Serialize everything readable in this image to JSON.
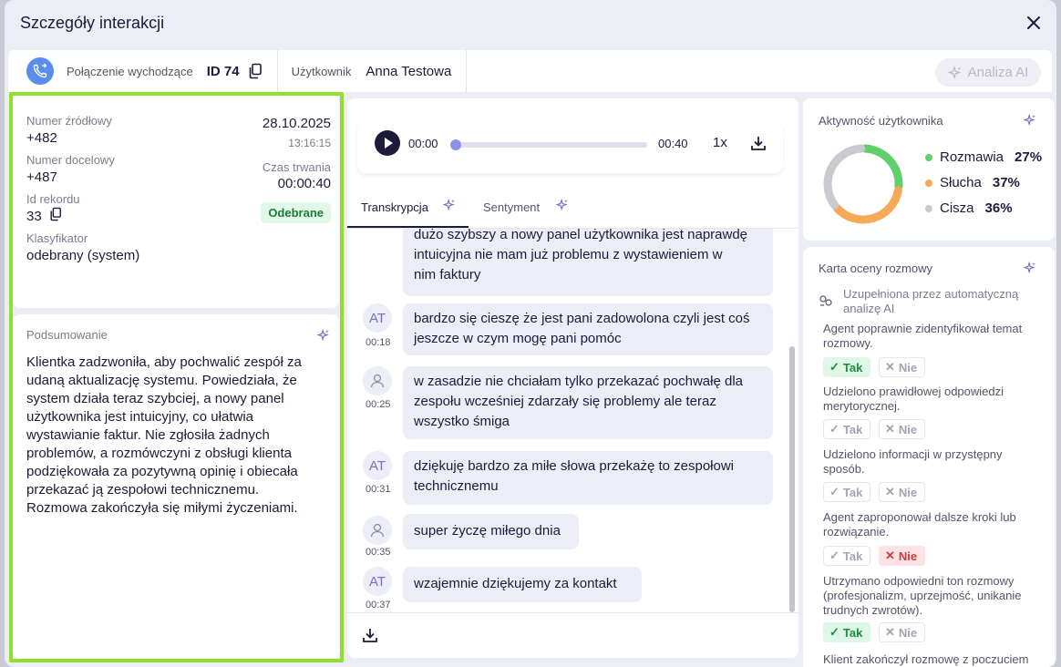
{
  "modal": {
    "title": "Szczegóły interakcji"
  },
  "infobar": {
    "call_type": "Połączenie wychodzące",
    "id": "ID 74",
    "user_label": "Użytkownik",
    "user_name": "Anna Testowa",
    "ai_button": "Analiza AI"
  },
  "details": {
    "source_label": "Numer źródłowy",
    "source_value": "+482",
    "date": "28.10.2025",
    "time": "13:16:15",
    "target_label": "Numer docelowy",
    "target_value": "+487",
    "duration_label": "Czas trwania",
    "duration_value": "00:00:40",
    "record_label": "Id rekordu",
    "record_value": "33",
    "status": "Odebrane",
    "classifier_label": "Klasyfikator",
    "classifier_value": "odebrany (system)"
  },
  "summary": {
    "title": "Podsumowanie",
    "lines": [
      "Klientka zadzwoniła, aby pochwalić zespół za",
      "udaną aktualizację systemu. Powiedziała, że",
      "system działa teraz szybciej, a nowy panel",
      "użytkownika jest intuicyjny, co ułatwia",
      "wystawianie faktur. Nie zgłosiła żadnych",
      "problemów, a rozmówczyni z obsługi klienta",
      "podziękowała za pozytywną opinię i obiecała",
      "przekazać ją zespołowi technicznemu.",
      "Rozmowa zakończyła się miłymi życzeniami."
    ]
  },
  "player": {
    "current": "00:00",
    "total": "00:40",
    "speed": "1x",
    "progress": 0
  },
  "tabs": [
    {
      "label": "Transkrypcja",
      "active": true
    },
    {
      "label": "Sentyment",
      "active": false
    }
  ],
  "transcript": [
    {
      "speaker": "",
      "time": "",
      "lines": [
        "dużo szybszy a nowy panel użytkownika jest naprawdę",
        "intuicyjna nie mam już problemu z wystawieniem w",
        "nim faktury"
      ]
    },
    {
      "speaker": "AT",
      "time": "00:18",
      "lines": [
        "bardzo się cieszę że jest pani zadowolona czyli jest coś",
        "jeszcze w czym mogę pani pomóc"
      ]
    },
    {
      "speaker": "user",
      "time": "00:25",
      "lines": [
        "w zasadzie nie chciałam tylko przekazać pochwałę dla",
        "zespołu wcześniej zdarzały się problemy ale teraz",
        "wszystko śmiga"
      ]
    },
    {
      "speaker": "AT",
      "time": "00:31",
      "lines": [
        "dziękuję bardzo za miłe słowa przekażę to zespołowi",
        "technicznemu"
      ]
    },
    {
      "speaker": "user",
      "time": "00:35",
      "lines": [
        "super życzę miłego dnia"
      ]
    },
    {
      "speaker": "AT",
      "time": "00:37",
      "lines": [
        "wzajemnie dziękujemy za kontakt"
      ]
    }
  ],
  "activity": {
    "title": "Aktywność użytkownika",
    "items": [
      {
        "label": "Rozmawia",
        "value": "27%",
        "pct": 27,
        "color": "#5fd06d"
      },
      {
        "label": "Słucha",
        "value": "37%",
        "pct": 37,
        "color": "#f6a956"
      },
      {
        "label": "Cisza",
        "value": "36%",
        "pct": 36,
        "color": "#c9c9cf"
      }
    ]
  },
  "scorecard": {
    "title": "Karta oceny rozmowy",
    "filled_by": [
      "Uzupełniona przez automatyczną",
      "analizę AI"
    ],
    "yes": "Tak",
    "no": "Nie",
    "questions": [
      {
        "lines": [
          "Agent poprawnie zidentyfikował temat",
          "rozmowy."
        ],
        "answer": "yes"
      },
      {
        "lines": [
          "Udzielono prawidłowej odpowiedzi",
          "merytorycznej."
        ],
        "answer": "none"
      },
      {
        "lines": [
          "Udzielono informacji w przystępny",
          "sposób."
        ],
        "answer": "none"
      },
      {
        "lines": [
          "Agent zaproponował dalsze kroki lub",
          "rozwiązanie."
        ],
        "answer": "no"
      },
      {
        "lines": [
          "Utrzymano odpowiedni ton rozmowy",
          "(profesjonalizm, uprzejmość, unikanie",
          "trudnych zwrotów)."
        ],
        "answer": "yes"
      }
    ],
    "next_partial": "Klient zakończył rozmowę z poczuciem"
  }
}
